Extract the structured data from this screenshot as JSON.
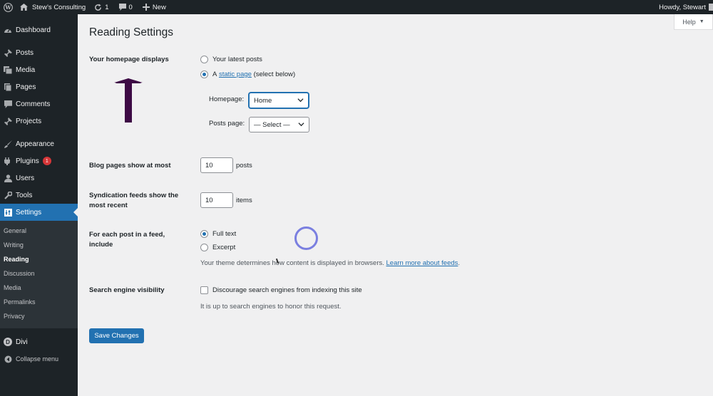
{
  "admin_bar": {
    "site_name": "Stew's Consulting",
    "updates_count": "1",
    "comments_count": "0",
    "new_label": "New",
    "howdy": "Howdy, Stewart"
  },
  "sidebar": {
    "items": [
      {
        "label": "Dashboard",
        "icon": "dashboard-icon"
      },
      {
        "label": "Posts",
        "icon": "pin-icon"
      },
      {
        "label": "Media",
        "icon": "media-icon"
      },
      {
        "label": "Pages",
        "icon": "page-icon"
      },
      {
        "label": "Comments",
        "icon": "comment-icon"
      },
      {
        "label": "Projects",
        "icon": "pin-icon"
      },
      {
        "label": "Appearance",
        "icon": "brush-icon"
      },
      {
        "label": "Plugins",
        "icon": "plugin-icon",
        "badge": "1"
      },
      {
        "label": "Users",
        "icon": "users-icon"
      },
      {
        "label": "Tools",
        "icon": "wrench-icon"
      },
      {
        "label": "Settings",
        "icon": "settings-icon"
      },
      {
        "label": "Divi",
        "icon": "divi-icon"
      },
      {
        "label": "Collapse menu",
        "icon": "collapse-icon"
      }
    ],
    "submenu": [
      "General",
      "Writing",
      "Reading",
      "Discussion",
      "Media",
      "Permalinks",
      "Privacy"
    ],
    "current_submenu": "Reading",
    "divi_letter": "D"
  },
  "help": {
    "label": "Help",
    "arrow": "▼"
  },
  "page": {
    "title": "Reading Settings",
    "homepage_displays": {
      "label": "Your homepage displays",
      "option_latest": "Your latest posts",
      "option_static_prefix": "A",
      "option_static_link": "static page",
      "option_static_suffix": "(select below)",
      "selected": "static",
      "homepage_label": "Homepage:",
      "homepage_value": "Home",
      "posts_page_label": "Posts page:",
      "posts_page_value": "— Select —"
    },
    "blog_pages": {
      "label": "Blog pages show at most",
      "value": "10",
      "unit": "posts"
    },
    "syndication": {
      "label": "Syndication feeds show the most recent",
      "value": "10",
      "unit": "items"
    },
    "feed_content": {
      "label": "For each post in a feed, include",
      "option_full": "Full text",
      "option_excerpt": "Excerpt",
      "selected": "full",
      "desc_prefix": "Your theme determines how content is displayed in browsers.",
      "desc_link": "Learn more about feeds",
      "desc_suffix": "."
    },
    "search_visibility": {
      "label": "Search engine visibility",
      "checkbox_label": "Discourage search engines from indexing this site",
      "checked": false,
      "desc": "It is up to search engines to honor this request."
    },
    "save_label": "Save Changes"
  },
  "colors": {
    "accent": "#2271b1",
    "sidebar_bg": "#1d2327",
    "annotation_arrow": "#3d0a45",
    "spinner": "#7a7fe0"
  }
}
